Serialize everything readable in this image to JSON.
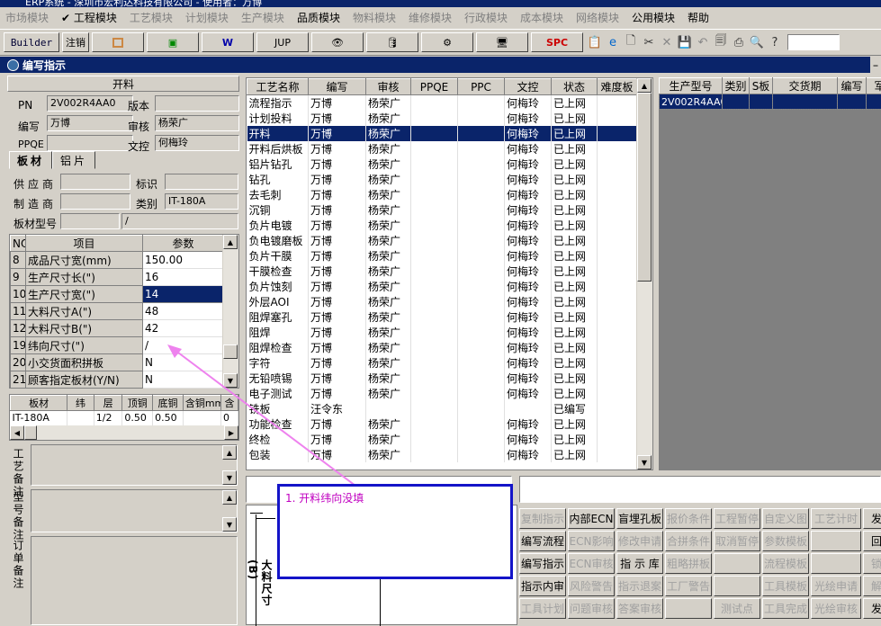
{
  "app": {
    "title": "ERP系统 - 深圳市宏利达科技有限公司 - 使用者：万博"
  },
  "menu": [
    {
      "label": "市场模块",
      "enabled": false
    },
    {
      "label": "✔ 工程模块",
      "enabled": true
    },
    {
      "label": "工艺模块",
      "enabled": false
    },
    {
      "label": "计划模块",
      "enabled": false
    },
    {
      "label": "生产模块",
      "enabled": false
    },
    {
      "label": "品质模块",
      "enabled": true
    },
    {
      "label": "物料模块",
      "enabled": false
    },
    {
      "label": "维修模块",
      "enabled": false
    },
    {
      "label": "行政模块",
      "enabled": false
    },
    {
      "label": "成本模块",
      "enabled": false
    },
    {
      "label": "网络模块",
      "enabled": false
    },
    {
      "label": "公用模块",
      "enabled": true
    },
    {
      "label": "帮助",
      "enabled": true
    }
  ],
  "toolbar": {
    "builder": "Builder",
    "logout": "注销",
    "jup": "JUP",
    "spc": "SPC"
  },
  "window": {
    "title": "编写指示"
  },
  "cutting": {
    "section_title": "开料",
    "pn_label": "PN",
    "pn_value": "2V002R4AA0",
    "version_label": "版本",
    "version_value": "",
    "writer_label": "编写",
    "writer_value": "万博",
    "reviewer_label": "审核",
    "reviewer_value": "杨荣广",
    "ppqe_label": "PPQE",
    "ppqe_value": "",
    "doc_label": "文控",
    "doc_value": "何梅玲",
    "tabs": [
      "板材",
      "铝片"
    ],
    "supplier_label": "供应商",
    "supplier_value": "",
    "mark_label": "标识",
    "mark_value": "",
    "maker_label": "制造商",
    "maker_value": "",
    "category_label": "类别",
    "category_value": "IT-180A",
    "board_model_label": "板材型号",
    "board_model_value": "",
    "board_model_value2": "/"
  },
  "params": {
    "headers": [
      "NO",
      "项目",
      "参数"
    ],
    "rows": [
      {
        "no": "8",
        "item": "成品尺寸宽(mm)",
        "value": "150.00"
      },
      {
        "no": "9",
        "item": "生产尺寸长(\")",
        "value": "16"
      },
      {
        "no": "10",
        "item": "生产尺寸宽(\")",
        "value": "14",
        "selected": true
      },
      {
        "no": "11",
        "item": "大料尺寸A(\")",
        "value": "48"
      },
      {
        "no": "12",
        "item": "大料尺寸B(\")",
        "value": "42"
      },
      {
        "no": "19",
        "item": "纬向尺寸(\")",
        "value": "/"
      },
      {
        "no": "20",
        "item": "小交货面积拼板",
        "value": "N"
      },
      {
        "no": "21",
        "item": "顾客指定板材(Y/N)",
        "value": "N"
      }
    ]
  },
  "material": {
    "headers": [
      "板材",
      "纬",
      "层",
      "顶铜",
      "底铜",
      "含铜mm",
      "含"
    ],
    "row": [
      "IT-180A",
      "",
      "1/2",
      "0.50",
      "0.50",
      "",
      "0"
    ]
  },
  "notes": {
    "process_note": "工艺备注",
    "model_note": "型号备注",
    "order_note": "订单备注"
  },
  "process": {
    "headers": [
      "工艺名称",
      "编写",
      "审核",
      "PPQE",
      "PPC",
      "文控",
      "状态",
      "难度板"
    ],
    "rows": [
      [
        "流程指示",
        "万博",
        "杨荣广",
        "",
        "",
        "何梅玲",
        "已上网",
        ""
      ],
      [
        "计划投料",
        "万博",
        "杨荣广",
        "",
        "",
        "何梅玲",
        "已上网",
        ""
      ],
      [
        "开料",
        "万博",
        "杨荣广",
        "",
        "",
        "何梅玲",
        "已上网",
        ""
      ],
      [
        "开料后烘板",
        "万博",
        "杨荣广",
        "",
        "",
        "何梅玲",
        "已上网",
        ""
      ],
      [
        "铝片钻孔",
        "万博",
        "杨荣广",
        "",
        "",
        "何梅玲",
        "已上网",
        ""
      ],
      [
        "钻孔",
        "万博",
        "杨荣广",
        "",
        "",
        "何梅玲",
        "已上网",
        ""
      ],
      [
        "去毛刺",
        "万博",
        "杨荣广",
        "",
        "",
        "何梅玲",
        "已上网",
        ""
      ],
      [
        "沉铜",
        "万博",
        "杨荣广",
        "",
        "",
        "何梅玲",
        "已上网",
        ""
      ],
      [
        "负片电镀",
        "万博",
        "杨荣广",
        "",
        "",
        "何梅玲",
        "已上网",
        ""
      ],
      [
        "负电镀磨板",
        "万博",
        "杨荣广",
        "",
        "",
        "何梅玲",
        "已上网",
        ""
      ],
      [
        "负片干膜",
        "万博",
        "杨荣广",
        "",
        "",
        "何梅玲",
        "已上网",
        ""
      ],
      [
        "干膜检查",
        "万博",
        "杨荣广",
        "",
        "",
        "何梅玲",
        "已上网",
        ""
      ],
      [
        "负片蚀刻",
        "万博",
        "杨荣广",
        "",
        "",
        "何梅玲",
        "已上网",
        ""
      ],
      [
        "外层AOI",
        "万博",
        "杨荣广",
        "",
        "",
        "何梅玲",
        "已上网",
        ""
      ],
      [
        "阻焊塞孔",
        "万博",
        "杨荣广",
        "",
        "",
        "何梅玲",
        "已上网",
        ""
      ],
      [
        "阻焊",
        "万博",
        "杨荣广",
        "",
        "",
        "何梅玲",
        "已上网",
        ""
      ],
      [
        "阻焊检查",
        "万博",
        "杨荣广",
        "",
        "",
        "何梅玲",
        "已上网",
        ""
      ],
      [
        "字符",
        "万博",
        "杨荣广",
        "",
        "",
        "何梅玲",
        "已上网",
        ""
      ],
      [
        "无铅喷锡",
        "万博",
        "杨荣广",
        "",
        "",
        "何梅玲",
        "已上网",
        ""
      ],
      [
        "电子测试",
        "万博",
        "杨荣广",
        "",
        "",
        "何梅玲",
        "已上网",
        ""
      ],
      [
        "铣板",
        "汪令东",
        "",
        "",
        "",
        "",
        "已编写",
        ""
      ],
      [
        "功能检查",
        "万博",
        "杨荣广",
        "",
        "",
        "何梅玲",
        "已上网",
        ""
      ],
      [
        "终检",
        "万博",
        "杨荣广",
        "",
        "",
        "何梅玲",
        "已上网",
        ""
      ],
      [
        "包装",
        "万博",
        "杨荣广",
        "",
        "",
        "何梅玲",
        "已上网",
        ""
      ]
    ],
    "selected_index": 2
  },
  "products": {
    "headers": [
      "生产型号",
      "类别",
      "S板",
      "交货期",
      "编写",
      "军"
    ],
    "rows": [
      [
        "2V002R4AA0",
        "",
        "",
        "",
        "",
        ""
      ]
    ]
  },
  "annotation": {
    "text": "1. 开料纬向没填"
  },
  "drawing": {
    "label": "大料尺寸(B)"
  },
  "buttons": [
    [
      "复制指示",
      "内部ECN",
      "盲埋孔板",
      "报价条件",
      "工程暂停",
      "自定义图",
      "工艺计时",
      "发"
    ],
    [
      "编写流程",
      "ECN影响",
      "修改申请",
      "合拼条件",
      "取消暂停",
      "参数模板",
      "",
      "回"
    ],
    [
      "编写指示",
      "ECN审核",
      "指 示 库",
      "粗略拼板",
      "",
      "流程模板",
      "",
      "锁"
    ],
    [
      "指示内审",
      "风险警告",
      "指示退案",
      "工厂警告",
      "",
      "工具模板",
      "光绘申请",
      "解"
    ],
    [
      "工具计划",
      "问题审核",
      "答案审核",
      "",
      "测试点",
      "工具完成",
      "光绘审核",
      "发"
    ]
  ],
  "buttons_enabled": [
    [
      false,
      true,
      true,
      false,
      false,
      false,
      false,
      true
    ],
    [
      true,
      false,
      false,
      false,
      false,
      false,
      false,
      true
    ],
    [
      true,
      false,
      true,
      false,
      false,
      false,
      false,
      false
    ],
    [
      true,
      false,
      false,
      false,
      false,
      false,
      false,
      false
    ],
    [
      false,
      false,
      false,
      false,
      false,
      false,
      false,
      true
    ]
  ],
  "colors": {
    "selection": "#0a246a",
    "annotation": "#ee82ee",
    "frame": "#1414c8"
  }
}
